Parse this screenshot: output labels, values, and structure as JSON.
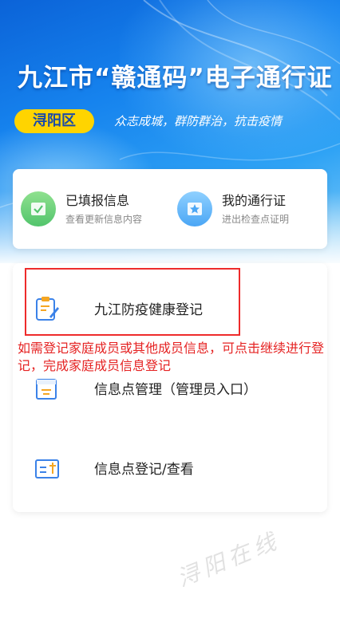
{
  "header": {
    "title": "九江市“赣通码”电子通行证",
    "district": "浔阳区",
    "slogan": "众志成城，群防群治，抗击疫情"
  },
  "quick_entries": [
    {
      "label": "已填报信息",
      "sub": "查看更新信息内容",
      "icon": "form-check-icon"
    },
    {
      "label": "我的通行证",
      "sub": "进出检查点证明",
      "icon": "pass-star-icon"
    }
  ],
  "menu": [
    {
      "label": "九江防疫健康登记",
      "icon": "clipboard-edit-icon"
    },
    {
      "label": "信息点管理（管理员入口）",
      "icon": "document-manage-icon"
    },
    {
      "label": "信息点登记/查看",
      "icon": "card-register-icon"
    }
  ],
  "annotation": {
    "note": "如需登记家庭成员或其他成员信息，可点击继续进行登记，完成家庭成员信息登记"
  },
  "colors": {
    "primary_blue": "#1683ee",
    "badge_yellow": "#ffd400",
    "annotation_red": "#e52222"
  }
}
